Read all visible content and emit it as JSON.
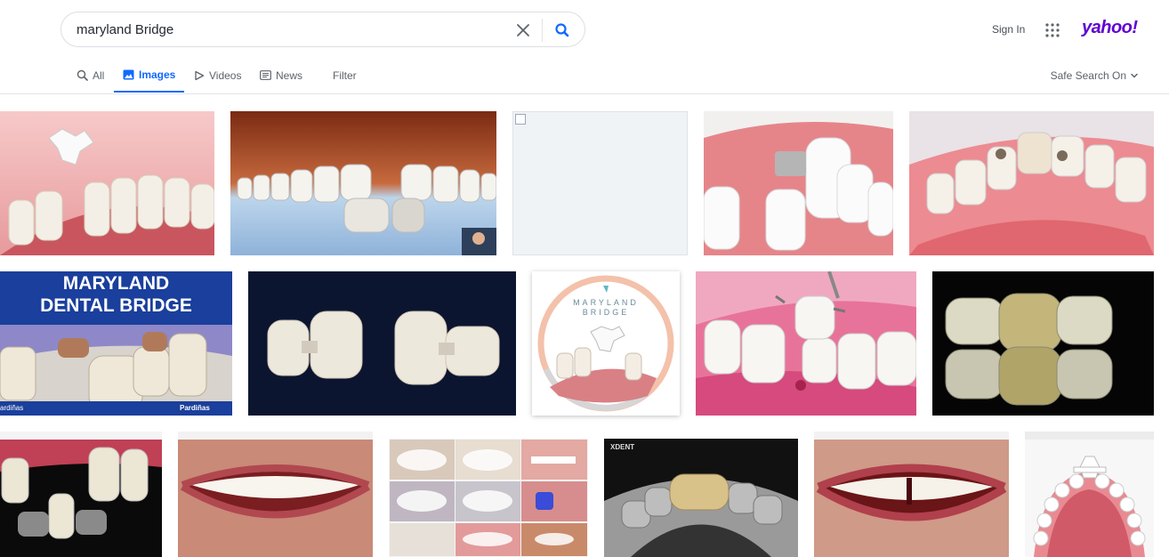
{
  "search": {
    "query": "maryland Bridge"
  },
  "header": {
    "sign_in": "Sign In",
    "logo": "yahoo!"
  },
  "tabs": [
    {
      "label": "All",
      "icon": "search-icon"
    },
    {
      "label": "Images",
      "icon": "image-icon",
      "active": true
    },
    {
      "label": "Videos",
      "icon": "play-icon"
    },
    {
      "label": "News",
      "icon": "newspaper-icon"
    },
    {
      "label": "Filter"
    }
  ],
  "safe_search": {
    "label": "Safe Search On"
  },
  "images": {
    "t6_line1": "MARYLAND",
    "t6_line2": "DENTAL BRIDGE",
    "t6_left_credit": "ardiñas",
    "t6_right_credit": "Pardiñas",
    "t8_line1": "MARYLAND",
    "t8_line2": "BRIDGE",
    "t14_brand": "XDENT"
  },
  "colors": {
    "accent": "#0f69ff",
    "logo": "#6001d2"
  }
}
